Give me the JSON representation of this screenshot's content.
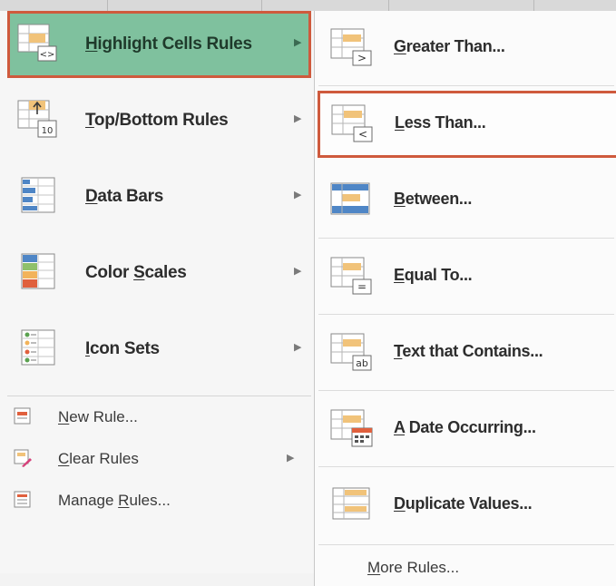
{
  "colors": {
    "selected_fill": "#7fc19e",
    "highlight_border": "#cf5a3d",
    "menu_bg": "#f6f6f6"
  },
  "main_menu": {
    "items": [
      {
        "label": "Highlight Cells Rules",
        "accel": "H",
        "icon": "highlight-cells-rules-icon",
        "selected": true,
        "has_submenu": true
      },
      {
        "label": "Top/Bottom Rules",
        "accel": "T",
        "icon": "top-bottom-rules-icon",
        "icon_text": "10",
        "has_submenu": true
      },
      {
        "label": "Data Bars",
        "accel": "D",
        "icon": "data-bars-icon",
        "has_submenu": true
      },
      {
        "label": "Color Scales",
        "accel": "S",
        "icon": "color-scales-icon",
        "has_submenu": true
      },
      {
        "label": "Icon Sets",
        "accel": "I",
        "icon": "icon-sets-icon",
        "has_submenu": true
      }
    ],
    "small_items": [
      {
        "label": "New Rule...",
        "accel": "N",
        "icon": "new-rule-icon"
      },
      {
        "label": "Clear Rules",
        "accel": "C",
        "icon": "clear-rules-icon",
        "has_submenu": true
      },
      {
        "label": "Manage Rules...",
        "accel": "R",
        "icon": "manage-rules-icon"
      }
    ]
  },
  "submenu": {
    "items": [
      {
        "label": "Greater Than...",
        "accel": "G",
        "icon": "greater-than-icon",
        "icon_text": ">"
      },
      {
        "label": "Less Than...",
        "accel": "L",
        "icon": "less-than-icon",
        "icon_text": "<",
        "selected": true
      },
      {
        "label": "Between...",
        "accel": "B",
        "icon": "between-icon"
      },
      {
        "label": "Equal To...",
        "accel": "E",
        "icon": "equal-to-icon",
        "icon_text": "="
      },
      {
        "label": "Text that Contains...",
        "accel": "T",
        "icon": "text-contains-icon",
        "icon_text": "ab"
      },
      {
        "label": "A Date Occurring...",
        "accel": "A",
        "icon": "date-occurring-icon"
      },
      {
        "label": "Duplicate Values...",
        "accel": "D",
        "icon": "duplicate-values-icon"
      }
    ],
    "more_rules": {
      "label": "More Rules...",
      "accel": "M"
    }
  }
}
